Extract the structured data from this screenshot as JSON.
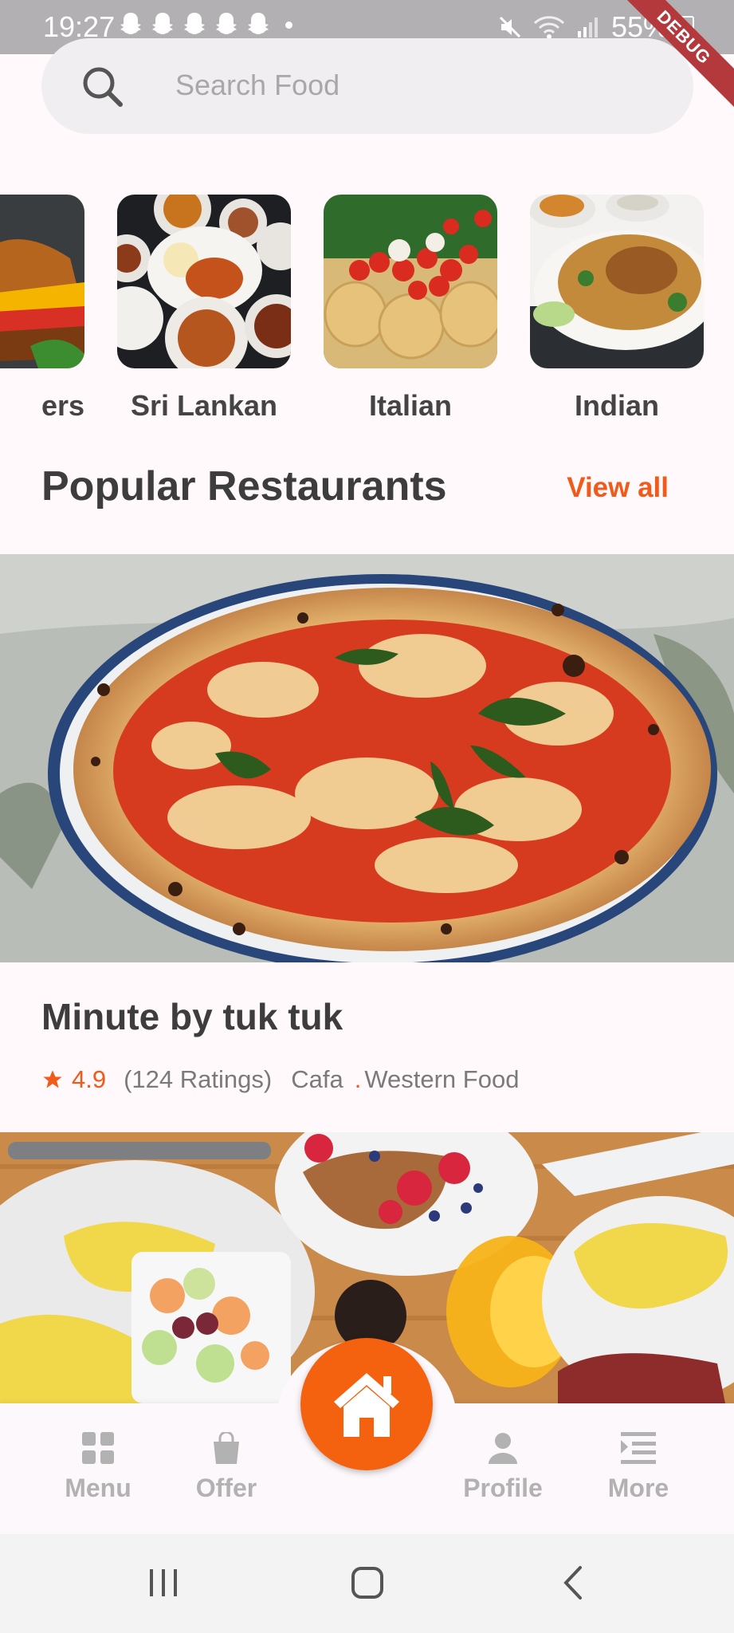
{
  "status_bar": {
    "time": "19:27",
    "battery": "55%"
  },
  "debug_banner": "DEBUG",
  "search": {
    "placeholder": "Search Food"
  },
  "categories": [
    {
      "label": "Burgers",
      "shown": "ers"
    },
    {
      "label": "Sri Lankan"
    },
    {
      "label": "Italian"
    },
    {
      "label": "Indian"
    }
  ],
  "section": {
    "title": "Popular Restaurants",
    "view_all": "View all"
  },
  "restaurant": {
    "name": "Minute by tuk tuk",
    "rating": "4.9",
    "ratings_count": "(124 Ratings)",
    "type": "Cafa",
    "dot": ".",
    "cuisine": "Western Food"
  },
  "bottom_nav": {
    "menu": "Menu",
    "offer": "Offer",
    "profile": "Profile",
    "more": "More"
  },
  "colors": {
    "accent": "#f5620f",
    "nav_inactive": "#b2b2b2"
  }
}
